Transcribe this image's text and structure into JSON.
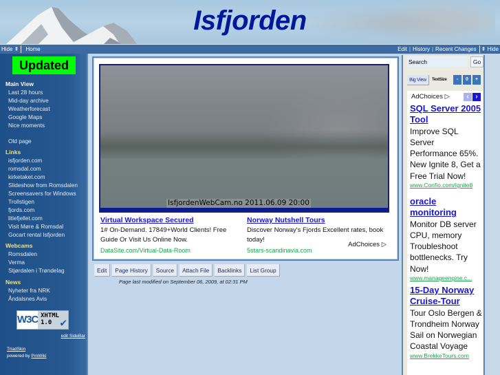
{
  "header": {
    "title": "Isfjorden"
  },
  "navbar": {
    "hide_left": "Hide ⇞",
    "home": "Home",
    "edit": "Edit",
    "history": "History",
    "recent_changes": "Recent Changes",
    "hide_right": "⇞ Hide",
    "separator": "|"
  },
  "sidebar": {
    "updated": "Updated",
    "sections": [
      {
        "heading": "Main View",
        "items": [
          "Last 28 hours",
          "Mid-day archive",
          "Weatherforecast",
          "Google Maps",
          "Nice moments",
          "Old page"
        ]
      },
      {
        "heading": "Links",
        "items": [
          "isfjorden.com",
          "romsdal.com",
          "kirketaket.com",
          "Slideshow from Romsdalen",
          "Screensavers for Windows",
          "Trollstigen",
          "fjords.com",
          "litlefjellet.com",
          "Visit Møre & Romsdal",
          "Gocart rental Isfjorden"
        ]
      },
      {
        "heading": "Webcams",
        "items": [
          "Romsdalen",
          "Verma",
          "Stjørdalen i Trøndelag"
        ]
      },
      {
        "heading": "News",
        "items": [
          "Nyheter fra NRK",
          "Åndalsnes Avis"
        ]
      }
    ],
    "w3c_badge": {
      "w3c": "W3C",
      "line1": "XHTML",
      "line2": "1.0",
      "check": "✔"
    },
    "edit_sidebar": "edit SideBar",
    "skin": "TriadSkin",
    "powered_by": "powered by",
    "pmwiki": "PmWiki"
  },
  "content": {
    "webcam_caption": "IsfjordenWebCam.no 2011.06.09 20:00",
    "ads": [
      {
        "title": "Virtual Workspace Secured",
        "text": "1# On-Demand. 17849+World Clients! Free Guide Or Visit Us Online Now.",
        "url": "DataSite.com/Virtual-Data-Room"
      },
      {
        "title": "Norway Nutshell Tours",
        "text": "Discover Norway's Fjords Excellent rates, book today!",
        "url": "5stars-scandinavia.com"
      }
    ],
    "adchoices": "AdChoices ▷"
  },
  "page_actions": {
    "buttons": [
      "Edit",
      "Page History",
      "Source",
      "Attach File",
      "Backlinks",
      "List Group"
    ],
    "last_modified": "Page last modified on September 06, 2009, at 02:31 PM"
  },
  "rightbar": {
    "search_placeholder": "Search",
    "search_value": "Search",
    "go": "Go",
    "big_view": "Big View",
    "text_size_label": "TextSize",
    "text_size_buttons": [
      "-",
      "0",
      "+"
    ],
    "adchoices": "AdChoices ▷",
    "prev": "‹",
    "next": "›",
    "ads": [
      {
        "title": "SQL Server 2005 Tool",
        "text": "Improve SQL Server Performance 65%. New Ignite 8, Get a Free Trial Now!",
        "url": "www.Confio.com/Ignite8"
      },
      {
        "title": "oracle monitoring",
        "text": "Monitor DB server CPU, memory Troubleshoot bottlenecks. Try Now!",
        "url": "www.manageengine.c..."
      },
      {
        "title": "15-Day Norway Cruise-Tour",
        "text": "Tour Oslo Bergen & Trondheim Norway Sail on Norwegian Coastal Voyage",
        "url": "www.BrekkeTours.com"
      }
    ]
  },
  "colors": {
    "title_blue": "#00189a",
    "nav_blue": "#3c6ba4",
    "sidebar_blue": "#27588f",
    "updated_green": "#00ff00",
    "ad_link": "#1a14d6",
    "ad_url": "#1aa34a",
    "sidebar_heading_yellow": "#f1e27a"
  }
}
